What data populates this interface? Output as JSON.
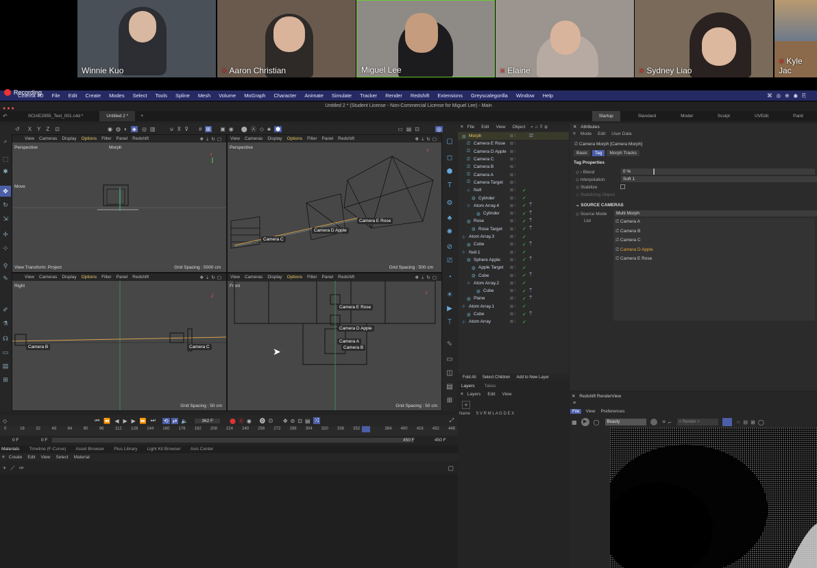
{
  "video_call": {
    "participants": [
      {
        "name": "Winnie Kuo",
        "muted": false,
        "bg": "#4a5058"
      },
      {
        "name": "Aaron Christian",
        "muted": true,
        "bg": "#6a5a4e"
      },
      {
        "name": "Miguel Lee",
        "muted": false,
        "bg": "#8e8a86"
      },
      {
        "name": "Elaine",
        "muted": true,
        "bg": "#9c948e"
      },
      {
        "name": "Sydney Liao",
        "muted": true,
        "bg": "#7a6a5a"
      },
      {
        "name": "Kyle Jac",
        "muted": true,
        "bg": "#8a6a4a"
      }
    ],
    "recording_label": "Recording"
  },
  "app": {
    "name": "Cinema 4D",
    "menu": [
      "File",
      "Edit",
      "Create",
      "Modes",
      "Select",
      "Tools",
      "Spline",
      "Mesh",
      "Volume",
      "MoGraph",
      "Character",
      "Animate",
      "Simulate",
      "Tracker",
      "Render",
      "Redshift",
      "Extensions",
      "Greyscalegorilla",
      "Window",
      "Help"
    ],
    "window_title": "Untitled 2 * (Student License - Non-Commercial License for Miguel Lee) - Main",
    "doc_tabs": [
      {
        "label": "SCIAE2955_Test_001.c4d *"
      },
      {
        "label": "Untitled 2 *",
        "active": true
      }
    ],
    "layout_tabs": [
      "Startup",
      "Standard",
      "Model",
      "Sculpt",
      "UVEdit",
      "Paint"
    ],
    "coord_labels": [
      "X",
      "Y",
      "Z"
    ]
  },
  "viewports": {
    "menu": [
      "View",
      "Cameras",
      "Display",
      "Options",
      "Filter",
      "Panel",
      "Redshift"
    ],
    "active_menu": "Options",
    "tl": {
      "name": "Perspective",
      "camera": "Morph",
      "mode": "Move",
      "footer_left": "View Transform: Project",
      "grid": "Grid Spacing : 5000 cm"
    },
    "tr": {
      "name": "Perspective",
      "grid": "Grid Spacing : 500 cm",
      "labels": [
        "Camera C",
        "Camera D Apple",
        "Camera E Rose"
      ]
    },
    "bl": {
      "name": "Right",
      "grid": "Grid Spacing : 50 cm",
      "labels": [
        "Camera B",
        "Camera C"
      ]
    },
    "br": {
      "name": "Front",
      "grid": "Grid Spacing : 50 cm",
      "labels": [
        "Camera E Rose",
        "Camera D Apple",
        "Camera A",
        "Camera B"
      ]
    }
  },
  "objects_panel": {
    "menu": [
      "File",
      "Edit",
      "View",
      "Object"
    ],
    "items": [
      {
        "name": "Morph",
        "indent": 0,
        "color": "#e6c96a"
      },
      {
        "name": "Camera E Rose",
        "indent": 1
      },
      {
        "name": "Camera D Apple",
        "indent": 1
      },
      {
        "name": "Camera C",
        "indent": 1
      },
      {
        "name": "Camera B",
        "indent": 1
      },
      {
        "name": "Camera A",
        "indent": 1
      },
      {
        "name": "Camera Target",
        "indent": 1
      },
      {
        "name": "Null",
        "indent": 1
      },
      {
        "name": "Cylinder",
        "indent": 2
      },
      {
        "name": "Atom Array.4",
        "indent": 1
      },
      {
        "name": "Cylinder",
        "indent": 3
      },
      {
        "name": "Rose",
        "indent": 1
      },
      {
        "name": "Rose Target",
        "indent": 2
      },
      {
        "name": "Atom Array.3",
        "indent": 0
      },
      {
        "name": "Cube",
        "indent": 1
      },
      {
        "name": "Null.1",
        "indent": 0
      },
      {
        "name": "Sphere Apple",
        "indent": 1
      },
      {
        "name": "Apple Target",
        "indent": 2
      },
      {
        "name": "Cube",
        "indent": 2
      },
      {
        "name": "Atom Array.2",
        "indent": 1
      },
      {
        "name": "Cube",
        "indent": 3
      },
      {
        "name": "Plane",
        "indent": 1
      },
      {
        "name": "Atom Array.1",
        "indent": 0
      },
      {
        "name": "Cube",
        "indent": 1
      },
      {
        "name": "Atom Array",
        "indent": 0
      }
    ],
    "bottom_buttons": [
      "Fold All",
      "Select Children",
      "Add to New Layer"
    ],
    "tabs": [
      "Layers",
      "Takes"
    ],
    "layers_menu": [
      "Layers",
      "Edit",
      "View"
    ],
    "layers_cols": "Name     S V R M L A G D E X"
  },
  "attributes": {
    "title": "Attributes",
    "menu": [
      "Mode",
      "Edit",
      "User Data"
    ],
    "object": "Camera Morph [Camera Morph]",
    "tabs": [
      "Basic",
      "Tag",
      "Morph Tracks"
    ],
    "active_tab": "Tag",
    "section": "Tag Properties",
    "blend_label": "Blend",
    "blend_value": "0 %",
    "blend_fraction": 0.0,
    "interp_label": "Interpolation",
    "interp_value": "Soft 1",
    "stabilize_label": "Stabilize",
    "stabobj_label": "Stabilizing Object",
    "source_section": "SOURCE CAMERAS",
    "source_mode_label": "Source Mode",
    "source_mode_value": "Multi Morph",
    "list_label": "List",
    "cameras": [
      {
        "name": "Camera A"
      },
      {
        "name": "Camera B"
      },
      {
        "name": "Camera C"
      },
      {
        "name": "Camera D Apple",
        "highlight": true
      },
      {
        "name": "Camera E Rose"
      }
    ]
  },
  "timeline": {
    "current_frame": "362 F",
    "ticks": [
      "0",
      "16",
      "32",
      "48",
      "64",
      "80",
      "96",
      "112",
      "128",
      "144",
      "160",
      "176",
      "192",
      "208",
      "224",
      "240",
      "256",
      "272",
      "288",
      "304",
      "320",
      "336",
      "352",
      "362",
      "384",
      "400",
      "416",
      "432",
      "448"
    ],
    "start": "0 F",
    "start2": "0 F",
    "end": "450 F",
    "end2": "450 F"
  },
  "bottom_tabs": [
    "Materials",
    "Timeline (F-Curve)",
    "Asset Browser",
    "Plus Library",
    "Light Kit Browser",
    "Axis Center"
  ],
  "materials_menu": [
    "Create",
    "Edit",
    "View",
    "Select",
    "Material"
  ],
  "renderview": {
    "title": "Redshift RenderView",
    "menu": [
      "File",
      "View",
      "Preferences"
    ],
    "aov": "Beauty",
    "render_sel": "< Render >"
  }
}
